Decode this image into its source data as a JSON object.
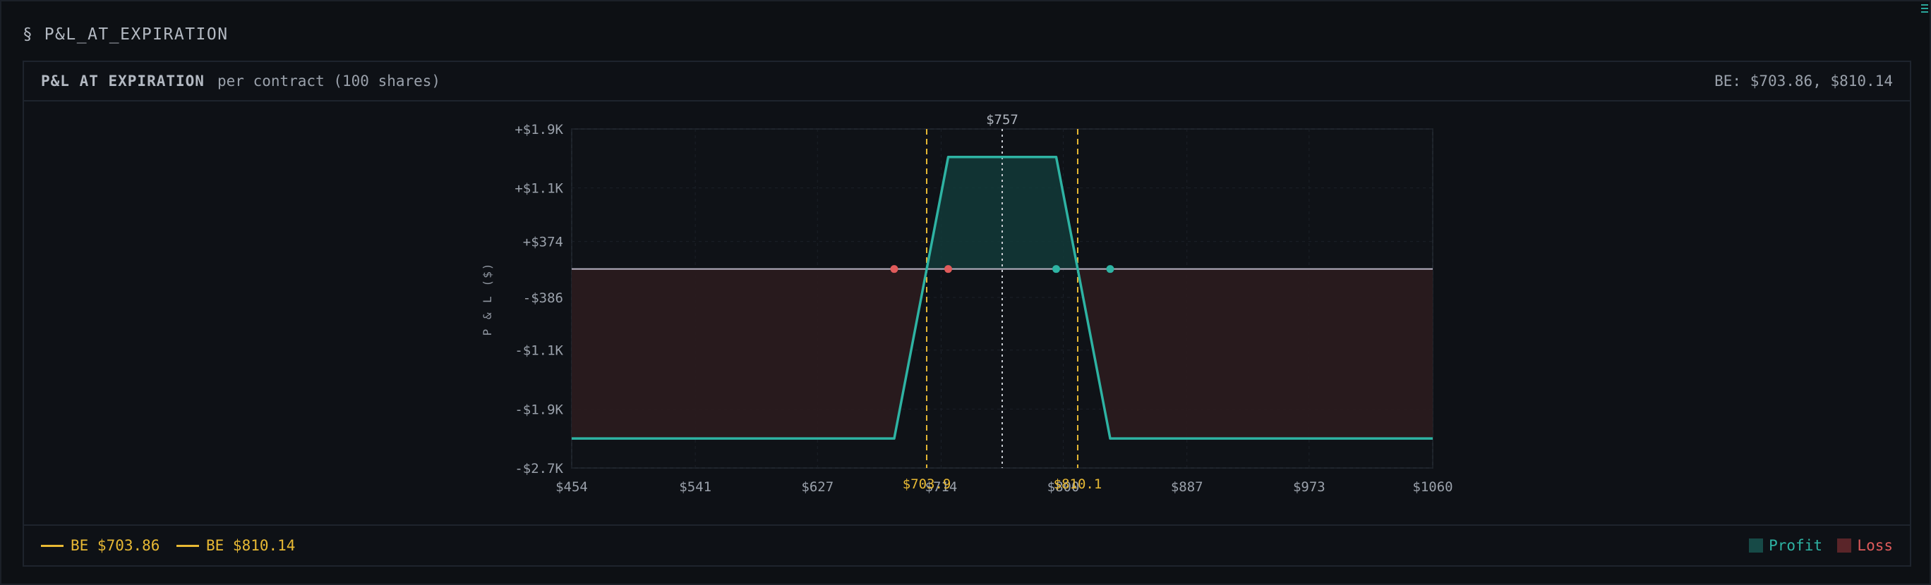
{
  "section": {
    "title": "§ P&L_AT_EXPIRATION"
  },
  "panel": {
    "title": "P&L AT EXPIRATION",
    "subtitle": "per contract (100 shares)",
    "breakevens_text": "BE: $703.86, $810.14"
  },
  "legend": {
    "be1": "BE $703.86",
    "be2": "BE $810.14",
    "profit": "Profit",
    "loss": "Loss"
  },
  "colors": {
    "profit": "#2eb3a3",
    "loss": "#e05b5b",
    "breakeven": "#e8b934",
    "profit_fill": "#123a38",
    "loss_fill": "#2a1b1e"
  },
  "chart_data": {
    "type": "line",
    "title": "",
    "xlabel": "",
    "ylabel": "P & L ($)",
    "xlim": [
      454,
      1060
    ],
    "ylim": [
      -2700,
      1900
    ],
    "x_ticks": [
      454,
      541,
      627,
      714,
      800,
      887,
      973,
      1060
    ],
    "x_tick_labels": [
      "$454",
      "$541",
      "$627",
      "$714",
      "$800",
      "$887",
      "$973",
      "$1060"
    ],
    "y_ticks": [
      1900,
      1100,
      374,
      -386,
      -1100,
      -1900,
      -2700
    ],
    "y_tick_labels": [
      "+$1.9K",
      "+$1.1K",
      "+$374",
      "-$386",
      "-$1.1K",
      "-$1.9K",
      "-$2.7K"
    ],
    "series": [
      {
        "x": [
          454,
          681,
          703.86,
          719,
          795,
          810.14,
          833,
          1060
        ],
        "y": [
          -2300,
          -2300,
          0,
          1520,
          1520,
          0,
          -2300,
          -2300
        ]
      }
    ],
    "breakevens": [
      703.86,
      810.14
    ],
    "breakeven_labels": [
      "$703.9",
      "$810.1"
    ],
    "current_price": 757,
    "current_price_label": "$757",
    "strike_markers": [
      {
        "x": 681,
        "side": "loss"
      },
      {
        "x": 719,
        "side": "loss"
      },
      {
        "x": 795,
        "side": "profit"
      },
      {
        "x": 833,
        "side": "profit"
      }
    ],
    "zero_line": 0,
    "grid": true
  }
}
